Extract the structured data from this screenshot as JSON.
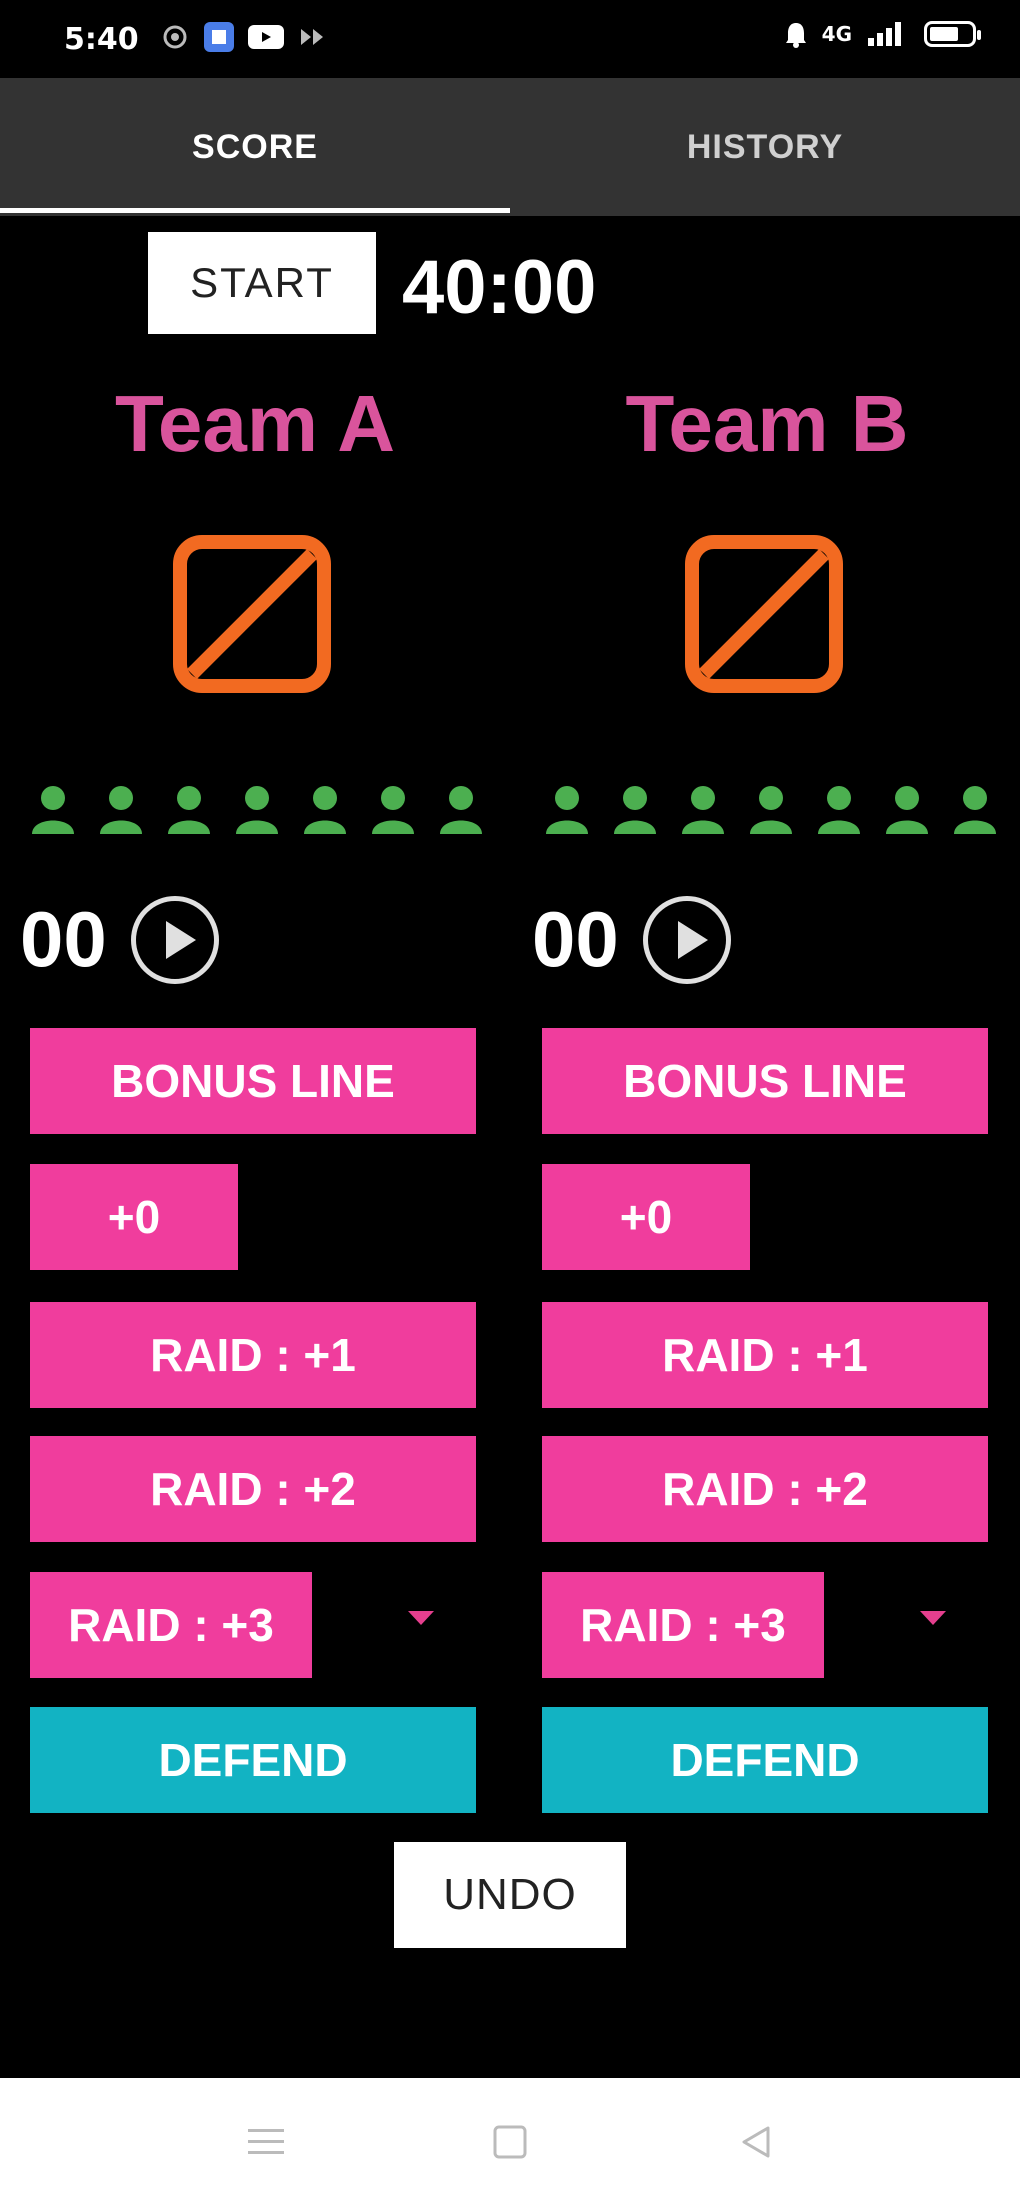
{
  "status_bar": {
    "time": "5:40",
    "right_text": "4G",
    "icons": [
      "settings-notification-icon",
      "photo-notification-icon",
      "youtube-icon",
      "media-icon",
      "alarm-icon",
      "signal-icon",
      "battery-icon"
    ]
  },
  "tabs": [
    {
      "label": "SCORE",
      "selected": true
    },
    {
      "label": "HISTORY",
      "selected": false
    }
  ],
  "timer": {
    "start_label": "START",
    "time": "40:00"
  },
  "teams": [
    {
      "name": "Team A",
      "logo_icon": "no-image-icon",
      "players": 7,
      "score": "00",
      "buttons": {
        "bonus": "BONUS LINE",
        "plus0": "+0",
        "raid1": "RAID : +1",
        "raid2": "RAID : +2",
        "raid3": "RAID : +3",
        "defend": "DEFEND"
      }
    },
    {
      "name": "Team B",
      "logo_icon": "no-image-icon",
      "players": 7,
      "score": "00",
      "buttons": {
        "bonus": "BONUS LINE",
        "plus0": "+0",
        "raid1": "RAID : +1",
        "raid2": "RAID : +2",
        "raid3": "RAID : +3",
        "defend": "DEFEND"
      }
    }
  ],
  "undo_label": "UNDO",
  "colors": {
    "accent_pink": "#f03d9d",
    "team_name_pink": "#d9549c",
    "defend_teal": "#12b3c3",
    "logo_orange": "#f26a21",
    "player_green": "#4caf50",
    "tab_bar": "#333333"
  },
  "nav_bar": [
    "menu-icon",
    "home-square-icon",
    "back-triangle-icon"
  ]
}
